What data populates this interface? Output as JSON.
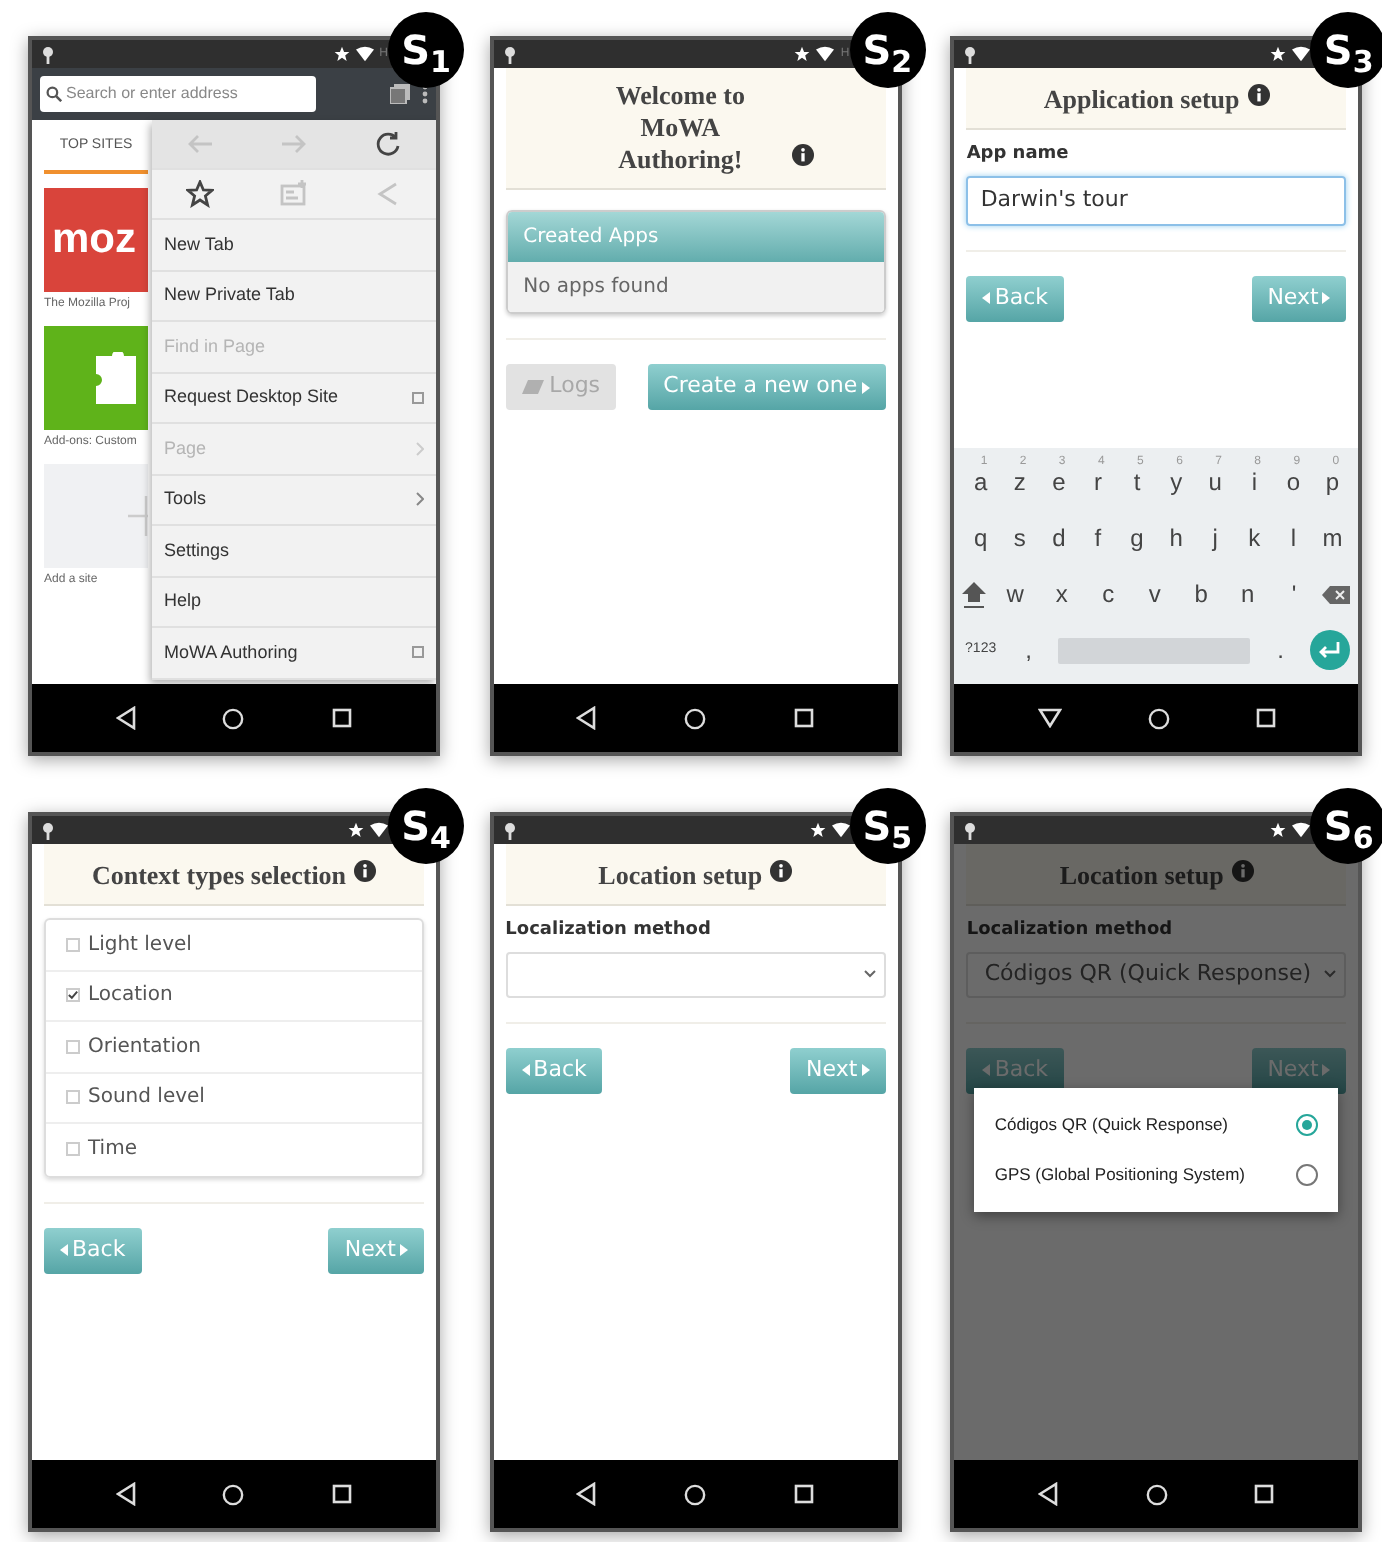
{
  "screens": [
    {
      "kind": "browser",
      "badge": "S$_{1}$",
      "network": "H",
      "address_placeholder": "Search or enter address",
      "top_sites_label": "TOP SITES",
      "tiles": [
        {
          "kind": "mozilla",
          "logo": "moz",
          "caption": "The Mozilla Proj"
        },
        {
          "kind": "addons",
          "caption": "Add-ons: Custom"
        },
        {
          "kind": "add",
          "caption": "Add a site"
        }
      ],
      "menu_toolbars": [
        [
          {
            "kind": "back",
            "disabled": true
          },
          {
            "kind": "forward",
            "disabled": true
          },
          {
            "kind": "reload",
            "disabled": false
          }
        ],
        [
          {
            "kind": "bookmark",
            "disabled": false
          },
          {
            "kind": "reading-list",
            "disabled": true
          },
          {
            "kind": "share",
            "disabled": true
          }
        ]
      ],
      "menu_items": [
        {
          "label": "New Tab",
          "kind": "plain",
          "disabled": false
        },
        {
          "label": "New Private Tab",
          "kind": "plain",
          "disabled": false
        },
        {
          "label": "Find in Page",
          "kind": "plain",
          "disabled": true
        },
        {
          "label": "Request Desktop Site",
          "kind": "checkbox",
          "checked": false,
          "disabled": false
        },
        {
          "label": "Page",
          "kind": "submenu",
          "disabled": true
        },
        {
          "label": "Tools",
          "kind": "submenu",
          "disabled": false
        },
        {
          "label": "Settings",
          "kind": "plain",
          "disabled": false
        },
        {
          "label": "Help",
          "kind": "plain",
          "disabled": false
        },
        {
          "label": "MoWA Authoring",
          "kind": "checkbox",
          "checked": false,
          "disabled": false
        }
      ]
    },
    {
      "kind": "welcome",
      "badge": "S$_{2}$",
      "network": "H",
      "title": "Welcome to MoWA Authoring!",
      "panel_title": "Created Apps",
      "panel_empty": "No apps found",
      "buttons": [
        {
          "kind": "logs",
          "label": "Logs",
          "disabled": true
        },
        {
          "kind": "next",
          "label": "Create a new one",
          "disabled": false
        }
      ]
    },
    {
      "kind": "app_setup",
      "badge": "S$_{3}$",
      "title": "Application setup",
      "field": {
        "label": "App name",
        "value": "Darwin's tour"
      },
      "buttons": [
        {
          "kind": "back",
          "label": "Back",
          "disabled": false
        },
        {
          "kind": "next",
          "label": "Next",
          "disabled": false
        }
      ],
      "keyboard": [
        [
          {
            "kind": "char",
            "label": "a",
            "hint": "1"
          },
          {
            "kind": "char",
            "label": "z",
            "hint": "2"
          },
          {
            "kind": "char",
            "label": "e",
            "hint": "3"
          },
          {
            "kind": "char",
            "label": "r",
            "hint": "4"
          },
          {
            "kind": "char",
            "label": "t",
            "hint": "5"
          },
          {
            "kind": "char",
            "label": "y",
            "hint": "6"
          },
          {
            "kind": "char",
            "label": "u",
            "hint": "7"
          },
          {
            "kind": "char",
            "label": "i",
            "hint": "8"
          },
          {
            "kind": "char",
            "label": "o",
            "hint": "9"
          },
          {
            "kind": "char",
            "label": "p",
            "hint": "0"
          }
        ],
        [
          {
            "kind": "char",
            "label": "q"
          },
          {
            "kind": "char",
            "label": "s"
          },
          {
            "kind": "char",
            "label": "d"
          },
          {
            "kind": "char",
            "label": "f"
          },
          {
            "kind": "char",
            "label": "g"
          },
          {
            "kind": "char",
            "label": "h"
          },
          {
            "kind": "char",
            "label": "j"
          },
          {
            "kind": "char",
            "label": "k"
          },
          {
            "kind": "char",
            "label": "l"
          },
          {
            "kind": "char",
            "label": "m"
          }
        ],
        [
          {
            "kind": "shift"
          },
          {
            "kind": "char",
            "label": "w"
          },
          {
            "kind": "char",
            "label": "x"
          },
          {
            "kind": "char",
            "label": "c"
          },
          {
            "kind": "char",
            "label": "v"
          },
          {
            "kind": "char",
            "label": "b"
          },
          {
            "kind": "char",
            "label": "n"
          },
          {
            "kind": "char",
            "label": "'"
          },
          {
            "kind": "backspace"
          }
        ],
        [
          {
            "kind": "small",
            "label": "?123"
          },
          {
            "kind": "char",
            "label": ","
          },
          {
            "kind": "space"
          },
          {
            "kind": "char",
            "label": "."
          },
          {
            "kind": "enter"
          }
        ]
      ]
    },
    {
      "kind": "context_types",
      "badge": "S$_{4}$",
      "title": "Context types selection",
      "options": [
        {
          "label": "Light level",
          "checked": false
        },
        {
          "label": "Location",
          "checked": true
        },
        {
          "label": "Orientation",
          "checked": false
        },
        {
          "label": "Sound level",
          "checked": false
        },
        {
          "label": "Time",
          "checked": false
        }
      ],
      "buttons": [
        {
          "kind": "back",
          "label": "Back",
          "disabled": false
        },
        {
          "kind": "next",
          "label": "Next",
          "disabled": false
        }
      ]
    },
    {
      "kind": "location",
      "badge": "S$_{5}$",
      "title": "Location setup",
      "field": {
        "label": "Localization method"
      },
      "dimmed": false,
      "buttons": [
        {
          "kind": "back",
          "label": "Back",
          "disabled": false
        },
        {
          "kind": "next",
          "label": "Next",
          "disabled": false
        }
      ]
    },
    {
      "kind": "location",
      "badge": "S$_{6}$",
      "title": "Location setup",
      "field": {
        "label": "Localization method",
        "value": "Códigos QR (Quick Response)"
      },
      "dimmed": true,
      "buttons": [
        {
          "kind": "back",
          "label": "Back",
          "disabled": false
        },
        {
          "kind": "next",
          "label": "Next",
          "disabled": false
        }
      ],
      "dialog_options": [
        {
          "label": "Códigos QR (Quick Response)",
          "selected": true
        },
        {
          "label": "GPS (Global Positioning System)",
          "selected": false
        }
      ]
    }
  ]
}
